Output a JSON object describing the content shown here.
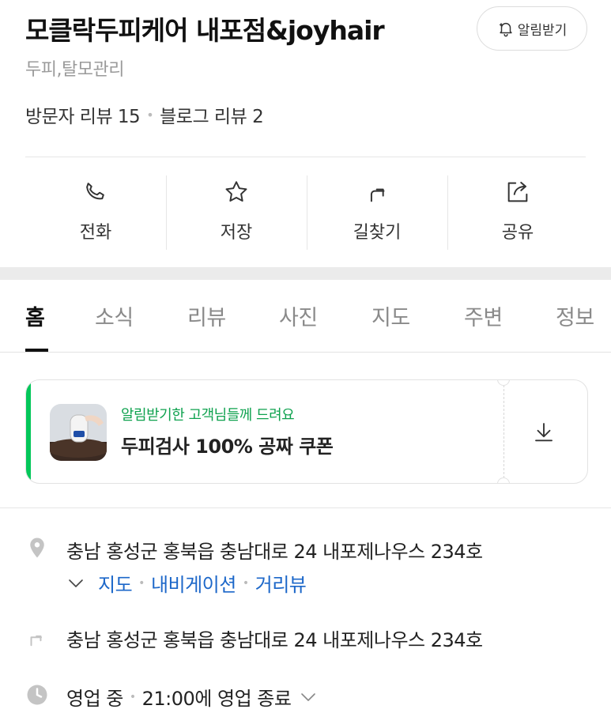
{
  "place": {
    "name": "모클락두피케어 내포점&joyhair",
    "category": "두피,탈모관리",
    "visitor_reviews": "방문자 리뷰 15",
    "blog_reviews": "블로그 리뷰 2",
    "notify_label": "알림받기"
  },
  "actions": [
    {
      "label": "전화",
      "icon": "phone-icon"
    },
    {
      "label": "저장",
      "icon": "star-icon"
    },
    {
      "label": "길찾기",
      "icon": "directions-arrow-icon"
    },
    {
      "label": "공유",
      "icon": "share-icon"
    }
  ],
  "tabs": [
    "홈",
    "소식",
    "리뷰",
    "사진",
    "지도",
    "주변",
    "정보"
  ],
  "active_tab": "홈",
  "coupon": {
    "subtitle": "알림받기한 고객님들께 드려요",
    "title": "두피검사 100% 공짜 쿠폰",
    "accent_color": "#03c75a"
  },
  "info": {
    "address": "충남 홍성군 홍북읍 충남대로 24 내포제나우스 234호",
    "links": [
      "지도",
      "내비게이션",
      "거리뷰"
    ],
    "directions_address": "충남 홍성군 홍북읍 충남대로 24 내포제나우스 234호",
    "status": "영업 중",
    "hours": "21:00에 영업 종료"
  },
  "colors": {
    "link": "#1c67c9",
    "brand_green": "#03c75a"
  }
}
